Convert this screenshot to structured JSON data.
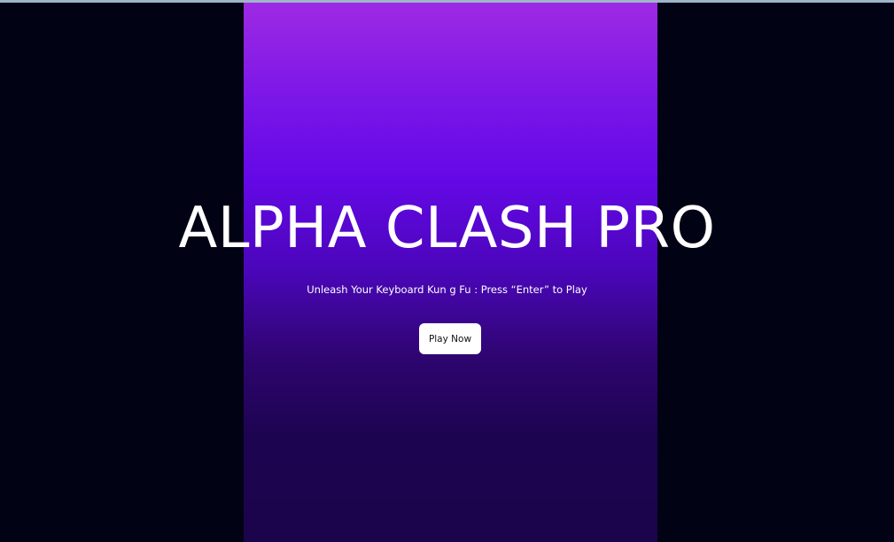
{
  "window": {
    "top_strip_color": "#9fb4cc"
  },
  "theme": {
    "page_background": "#010214",
    "panel_gradient": [
      "#9e2ae3",
      "#6408e6",
      "#2e056f",
      "#1b044b"
    ],
    "text_color": "#ffffff",
    "button_background": "#ffffff",
    "button_text_color": "#111111"
  },
  "hero": {
    "title": "ALPHA CLASH PRO",
    "subtitle": "Unleash Your Keyboard Kun g Fu : Press “Enter” to Play",
    "play_button_label": "Play Now"
  }
}
